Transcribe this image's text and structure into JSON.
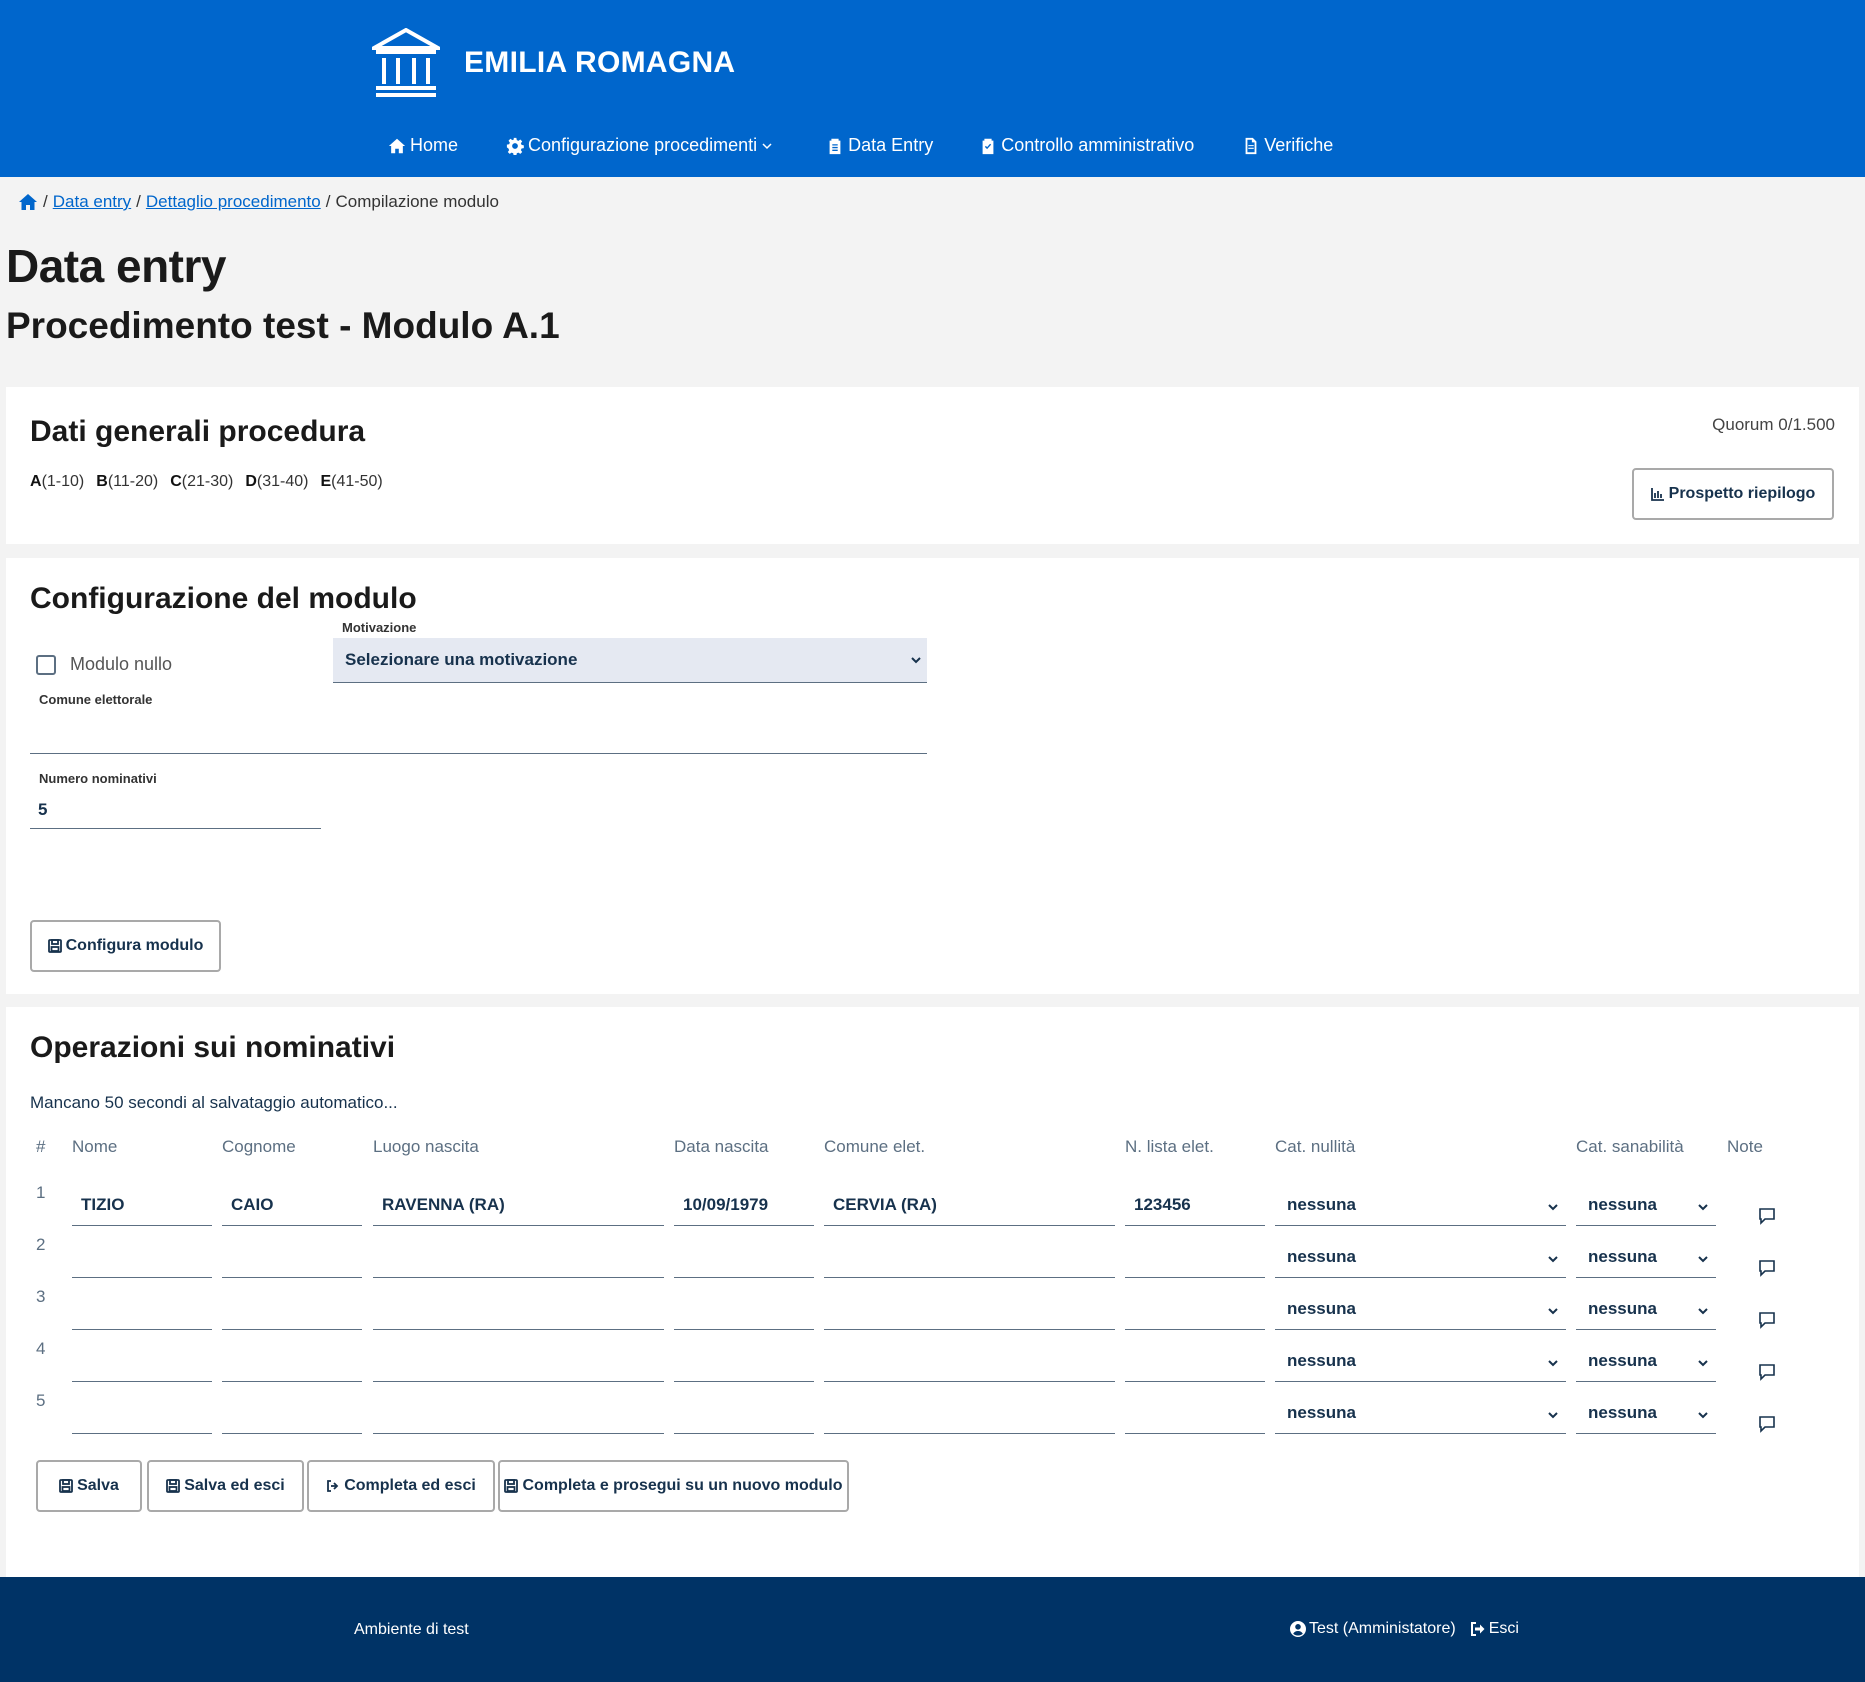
{
  "header": {
    "brand_title": "EMILIA ROMAGNA",
    "nav": [
      {
        "label": "Home",
        "icon": "home-icon"
      },
      {
        "label": "Configurazione procedimenti",
        "icon": "gear-icon"
      },
      {
        "label": "Data Entry",
        "icon": "clipboard-icon"
      },
      {
        "label": "Controllo amministrativo",
        "icon": "clipboard-check-icon"
      },
      {
        "label": "Verifiche",
        "icon": "document-icon"
      }
    ]
  },
  "breadcrumb": {
    "items": [
      "Data entry",
      "Dettaglio procedimento",
      "Compilazione modulo"
    ]
  },
  "page": {
    "title": "Data entry",
    "subtitle": "Procedimento test - Modulo A.1"
  },
  "general": {
    "title": "Dati generali procedura",
    "quorum": "Quorum 0/1.500",
    "ranges": [
      {
        "letter": "A",
        "range": "(1-10)"
      },
      {
        "letter": "B",
        "range": "(11-20)"
      },
      {
        "letter": "C",
        "range": "(21-30)"
      },
      {
        "letter": "D",
        "range": "(31-40)"
      },
      {
        "letter": "E",
        "range": "(41-50)"
      }
    ],
    "summary_button": "Prospetto riepilogo"
  },
  "config": {
    "title": "Configurazione del modulo",
    "null_module_label": "Modulo nullo",
    "motivation_label": "Motivazione",
    "motivation_value": "Selezionare una motivazione",
    "comune_label": "Comune elettorale",
    "comune_value": "",
    "count_label": "Numero nominativi",
    "count_value": "5",
    "configure_button": "Configura modulo"
  },
  "operations": {
    "title": "Operazioni sui nominativi",
    "autosave": "Mancano 50 secondi al salvataggio automatico...",
    "columns": [
      "#",
      "Nome",
      "Cognome",
      "Luogo nascita",
      "Data nascita",
      "Comune elet.",
      "N. lista elet.",
      "Cat. nullità",
      "Cat. sanabilità",
      "Note"
    ],
    "rows": [
      {
        "n": "1",
        "nome": "TIZIO",
        "cognome": "CAIO",
        "luogo": "RAVENNA (RA)",
        "data": "10/09/1979",
        "comune": "CERVIA (RA)",
        "lista": "123456",
        "nullita": "nessuna",
        "sanabilita": "nessuna"
      },
      {
        "n": "2",
        "nome": "",
        "cognome": "",
        "luogo": "",
        "data": "",
        "comune": "",
        "lista": "",
        "nullita": "nessuna",
        "sanabilita": "nessuna"
      },
      {
        "n": "3",
        "nome": "",
        "cognome": "",
        "luogo": "",
        "data": "",
        "comune": "",
        "lista": "",
        "nullita": "nessuna",
        "sanabilita": "nessuna"
      },
      {
        "n": "4",
        "nome": "",
        "cognome": "",
        "luogo": "",
        "data": "",
        "comune": "",
        "lista": "",
        "nullita": "nessuna",
        "sanabilita": "nessuna"
      },
      {
        "n": "5",
        "nome": "",
        "cognome": "",
        "luogo": "",
        "data": "",
        "comune": "",
        "lista": "",
        "nullita": "nessuna",
        "sanabilita": "nessuna"
      }
    ],
    "buttons": {
      "save": "Salva",
      "save_exit": "Salva ed esci",
      "complete_exit": "Completa ed esci",
      "complete_next": "Completa e prosegui su un nuovo modulo"
    }
  },
  "footer": {
    "environment": "Ambiente di test",
    "user": "Test (Amministatore)",
    "logout": "Esci"
  },
  "colors": {
    "header_bg": "#0066cc",
    "footer_bg": "#003366",
    "text_dark": "#17324d",
    "select_bg": "#e5e9f2"
  }
}
